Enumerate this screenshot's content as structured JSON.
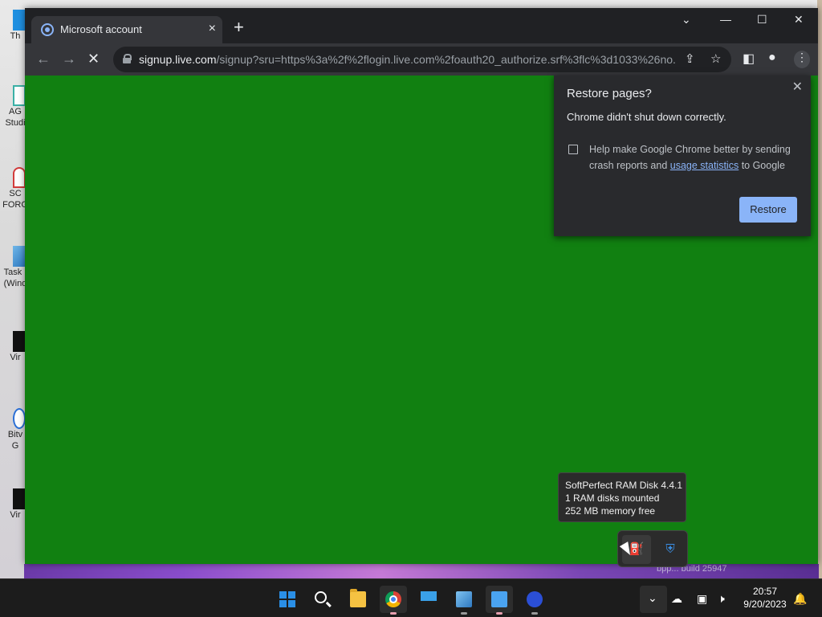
{
  "desktop": {
    "icons": [
      {
        "label": "Th"
      },
      {
        "label": "AG"
      },
      {
        "label": "Studi"
      },
      {
        "label": "SC"
      },
      {
        "label": "FORG"
      },
      {
        "label": "Task I"
      },
      {
        "label": "(Wind"
      },
      {
        "label": "Vir"
      },
      {
        "label": "Bitv"
      },
      {
        "label": "G"
      },
      {
        "label": "Vir"
      }
    ],
    "wallpaper_label": "bpp... build 25947"
  },
  "browser": {
    "tab": {
      "title": "Microsoft account",
      "close_icon": "×"
    },
    "new_tab_icon": "+",
    "window_controls": {
      "dropdown": "⌄",
      "minimize": "—",
      "maximize": "☐",
      "close": "✕"
    },
    "nav": {
      "back": "←",
      "forward": "→",
      "stop": "✕"
    },
    "url_host": "signup.live.com",
    "url_rest": "/signup?sru=https%3a%2f%2flogin.live.com%2foauth20_authorize.srf%3flc%3d1033%26no...",
    "content_color": "#118011"
  },
  "restore_popup": {
    "title": "Restore pages?",
    "message": "Chrome didn't shut down correctly.",
    "help_text_before": "Help make Google Chrome better by sending crash reports and ",
    "help_link": "usage statistics",
    "help_text_after": " to Google",
    "checkbox_checked": false,
    "button_label": "Restore",
    "close_icon": "✕"
  },
  "tray_tooltip": {
    "line1": "SoftPerfect RAM Disk 4.4.1",
    "line2": "1 RAM disks mounted",
    "line3": "252 MB memory free"
  },
  "taskbar": {
    "time": "20:57",
    "date": "9/20/2023"
  }
}
